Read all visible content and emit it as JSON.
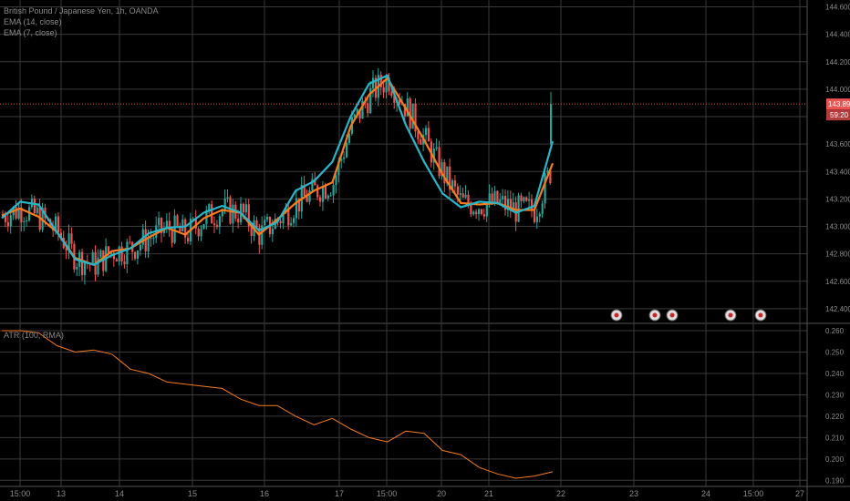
{
  "legend": {
    "symbol": "British Pound / Japanese Yen, 1h, OANDA",
    "ema14": "EMA (14, close)",
    "ema7": "EMA (7, close)",
    "atr": "ATR (100, RMA)"
  },
  "price_axis": {
    "ticks": [
      "144.600",
      "144.400",
      "144.200",
      "144.000",
      "143.800",
      "143.600",
      "143.400",
      "143.200",
      "143.000",
      "142.800",
      "142.600",
      "142.400"
    ],
    "current_price_label": "143.892",
    "countdown_label": "59:20"
  },
  "atr_axis": {
    "ticks": [
      "0.260",
      "0.250",
      "0.240",
      "0.230",
      "0.220",
      "0.210",
      "0.200",
      "0.190"
    ]
  },
  "time_axis": {
    "ticks": [
      "15:00",
      "13",
      "14",
      "15",
      "16",
      "17",
      "15:00",
      "20",
      "21",
      "22",
      "23",
      "24",
      "15:00",
      "27"
    ]
  },
  "colors": {
    "background": "#000000",
    "grid": "#3a3a3a",
    "up_candle": "#26a69a",
    "down_candle": "#ef5350",
    "ema14": "#29b6c8",
    "ema7": "#f57c1f",
    "atr": "#f57c1f",
    "price_line": "#ef5350",
    "axis_text": "#8a8a8a"
  },
  "chart_data": [
    {
      "type": "candlestick",
      "title": "British Pound / Japanese Yen, 1h, OANDA",
      "ylim": [
        142.3,
        144.65
      ],
      "last_price": 143.892,
      "series": [
        {
          "name": "EMA (14, close)",
          "values": [
            143.06,
            143.18,
            143.16,
            142.96,
            142.76,
            142.72,
            142.79,
            142.84,
            142.95,
            142.99,
            143.0,
            143.1,
            143.15,
            143.1,
            142.97,
            143.03,
            143.26,
            143.33,
            143.47,
            143.8,
            144.04,
            144.1,
            143.74,
            143.47,
            143.24,
            143.14,
            143.18,
            143.17,
            143.1,
            143.15,
            143.62
          ]
        },
        {
          "name": "EMA (7, close)",
          "values": [
            143.08,
            143.13,
            143.07,
            142.96,
            142.77,
            142.72,
            142.82,
            142.84,
            142.92,
            142.99,
            142.94,
            143.06,
            143.12,
            143.1,
            142.94,
            143.05,
            143.17,
            143.26,
            143.32,
            143.73,
            143.96,
            144.08,
            143.86,
            143.63,
            143.38,
            143.17,
            143.16,
            143.17,
            143.12,
            143.12,
            143.46
          ]
        }
      ],
      "x": [
        "12 15:00",
        "12 19:00",
        "13 00:00",
        "13 05:00",
        "13 10:00",
        "13 15:00",
        "14 00:00",
        "14 05:00",
        "14 10:00",
        "14 15:00",
        "15 00:00",
        "15 05:00",
        "15 10:00",
        "15 15:00",
        "16 00:00",
        "16 05:00",
        "16 10:00",
        "16 15:00",
        "17 00:00",
        "17 05:00",
        "17 10:00",
        "17 15:00",
        "17 20:00",
        "20 00:00",
        "20 05:00",
        "20 10:00",
        "20 15:00",
        "21 00:00",
        "21 05:00",
        "21 10:00",
        "21 15:00"
      ]
    },
    {
      "type": "line",
      "title": "ATR (100, RMA)",
      "ylim": [
        0.188,
        0.263
      ],
      "series": [
        {
          "name": "ATR (100, RMA)",
          "values": [
            0.26,
            0.26,
            0.259,
            0.253,
            0.25,
            0.251,
            0.249,
            0.242,
            0.24,
            0.236,
            0.235,
            0.234,
            0.233,
            0.228,
            0.225,
            0.225,
            0.22,
            0.216,
            0.219,
            0.214,
            0.21,
            0.208,
            0.213,
            0.212,
            0.204,
            0.202,
            0.196,
            0.193,
            0.191,
            0.192,
            0.194
          ]
        }
      ]
    }
  ]
}
